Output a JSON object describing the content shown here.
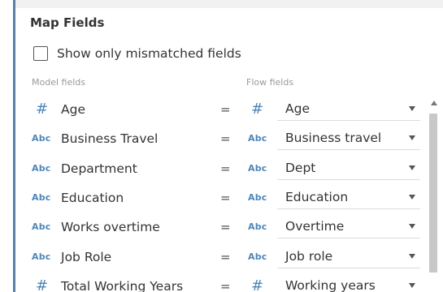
{
  "panel": {
    "title": "Map Fields",
    "show_mismatched_label": "Show only mismatched fields",
    "show_mismatched_checked": false
  },
  "columns": {
    "model": "Model fields",
    "flow": "Flow fields"
  },
  "type_labels": {
    "number": "#",
    "string": "Abc"
  },
  "equals_sign": "=",
  "rows": [
    {
      "model_field": "Age",
      "model_type": "number",
      "flow_field": "Age",
      "flow_type": "number"
    },
    {
      "model_field": "Business Travel",
      "model_type": "string",
      "flow_field": "Business travel",
      "flow_type": "string"
    },
    {
      "model_field": "Department",
      "model_type": "string",
      "flow_field": "Dept",
      "flow_type": "string"
    },
    {
      "model_field": "Education",
      "model_type": "string",
      "flow_field": "Education",
      "flow_type": "string"
    },
    {
      "model_field": "Works overtime",
      "model_type": "string",
      "flow_field": "Overtime",
      "flow_type": "string"
    },
    {
      "model_field": "Job Role",
      "model_type": "string",
      "flow_field": "Job role",
      "flow_type": "string"
    },
    {
      "model_field": "Total Working Years",
      "model_type": "number",
      "flow_field": "Working years",
      "flow_type": "number"
    }
  ],
  "icons": {
    "number_type": "hash-icon",
    "string_type": "abc-icon",
    "dropdown": "chevron-down-icon",
    "scroll_up": "scroll-up-arrow-icon"
  },
  "colors": {
    "type_icon": "#4e86b8",
    "accent_rule": "#5a7fa8",
    "text": "#333333",
    "muted": "#9a9a9a"
  }
}
